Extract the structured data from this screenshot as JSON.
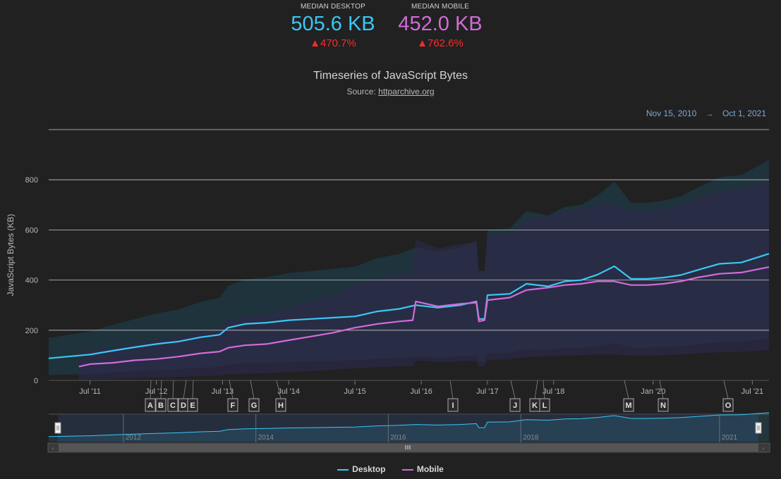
{
  "kpis": {
    "desktop": {
      "label": "MEDIAN DESKTOP",
      "value": "505.6 KB",
      "change": "▲470.7%",
      "color": "#38c8f5"
    },
    "mobile": {
      "label": "MEDIAN MOBILE",
      "value": "452.0 KB",
      "change": "▲762.6%",
      "color": "#d26bd8"
    }
  },
  "source": {
    "prefix": "Source:",
    "link": "httparchive.org"
  },
  "range": {
    "from": "Nov 15, 2010",
    "arrow": "→",
    "to": "Oct 1, 2021"
  },
  "navigator_labels": [
    "2012",
    "2014",
    "2016",
    "2018",
    "2021"
  ],
  "chart_data": {
    "type": "line",
    "title": "Timeseries of JavaScript Bytes",
    "ylabel": "JavaScript Bytes (KB)",
    "ylim": [
      0,
      1000
    ],
    "yticks": [
      0,
      200,
      400,
      600,
      800
    ],
    "x_range": [
      "2010-11-15",
      "2021-10-01"
    ],
    "xticks": [
      {
        "label": "Jul '11",
        "date": "2011-07-01"
      },
      {
        "label": "Jul '12",
        "date": "2012-07-01"
      },
      {
        "label": "Jul '13",
        "date": "2013-07-01"
      },
      {
        "label": "Jul '14",
        "date": "2014-07-01"
      },
      {
        "label": "Jul '15",
        "date": "2015-07-01"
      },
      {
        "label": "Jul '16",
        "date": "2016-07-01"
      },
      {
        "label": "Jul '17",
        "date": "2017-07-01"
      },
      {
        "label": "Jul '18",
        "date": "2018-07-01"
      },
      {
        "label": "Jan '20",
        "date": "2020-01-01"
      },
      {
        "label": "Jul '21",
        "date": "2021-07-01"
      }
    ],
    "grid": true,
    "legend_position": "bottom",
    "series": [
      {
        "name": "Desktop",
        "color": "#38c8f5",
        "x": [
          "2010-11-15",
          "2011-03-01",
          "2011-07-01",
          "2011-11-01",
          "2012-03-01",
          "2012-07-01",
          "2012-11-01",
          "2013-03-01",
          "2013-06-15",
          "2013-08-01",
          "2013-11-01",
          "2014-03-01",
          "2014-07-01",
          "2014-11-01",
          "2015-03-01",
          "2015-07-01",
          "2015-11-01",
          "2016-03-01",
          "2016-06-01",
          "2016-10-01",
          "2017-02-01",
          "2017-05-01",
          "2017-05-15",
          "2017-06-15",
          "2017-07-01",
          "2017-11-01",
          "2018-02-01",
          "2018-06-01",
          "2018-09-01",
          "2018-12-01",
          "2019-03-01",
          "2019-06-01",
          "2019-09-01",
          "2019-12-01",
          "2020-03-01",
          "2020-06-01",
          "2020-09-01",
          "2021-01-01",
          "2021-05-01",
          "2021-10-01"
        ],
        "y": [
          88,
          95,
          103,
          118,
          132,
          145,
          155,
          172,
          182,
          210,
          225,
          230,
          240,
          245,
          250,
          255,
          275,
          285,
          300,
          290,
          300,
          315,
          245,
          245,
          340,
          345,
          385,
          375,
          395,
          400,
          422,
          455,
          405,
          405,
          410,
          420,
          440,
          465,
          470,
          505
        ]
      },
      {
        "name": "Mobile",
        "color": "#d26bd8",
        "x": [
          "2011-05-01",
          "2011-07-01",
          "2011-11-01",
          "2012-03-01",
          "2012-07-01",
          "2012-11-01",
          "2013-03-01",
          "2013-06-15",
          "2013-08-01",
          "2013-11-01",
          "2014-03-01",
          "2014-07-01",
          "2014-11-01",
          "2015-03-01",
          "2015-07-01",
          "2015-11-01",
          "2016-03-01",
          "2016-05-15",
          "2016-06-01",
          "2016-10-01",
          "2017-02-01",
          "2017-05-01",
          "2017-05-15",
          "2017-06-15",
          "2017-07-01",
          "2017-11-01",
          "2018-02-01",
          "2018-06-01",
          "2018-09-01",
          "2018-12-01",
          "2019-03-01",
          "2019-06-01",
          "2019-09-01",
          "2019-12-01",
          "2020-03-01",
          "2020-06-01",
          "2020-09-01",
          "2021-01-01",
          "2021-05-01",
          "2021-10-01"
        ],
        "y": [
          55,
          65,
          70,
          80,
          85,
          95,
          108,
          115,
          130,
          140,
          145,
          160,
          175,
          190,
          210,
          225,
          235,
          240,
          315,
          295,
          305,
          310,
          235,
          240,
          320,
          330,
          360,
          370,
          380,
          385,
          395,
          395,
          380,
          380,
          385,
          395,
          410,
          425,
          430,
          452
        ]
      }
    ]
  },
  "annotations": [
    "A",
    "B",
    "C",
    "D",
    "E",
    "F",
    "G",
    "H",
    "I",
    "J",
    "K",
    "L",
    "M",
    "N",
    "O"
  ]
}
